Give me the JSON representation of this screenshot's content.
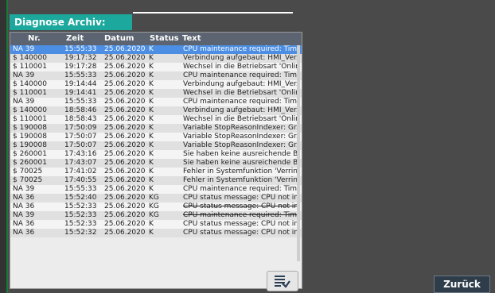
{
  "title": "Diagnose Archiv:",
  "table": {
    "headers": [
      "Nr.",
      "Zeit",
      "Datum",
      "Status",
      "Text"
    ],
    "rows": [
      {
        "nr": "NA  39",
        "zeit": "15:55:33",
        "datum": "25.06.2020",
        "status": "K",
        "text": "CPU maintenance required: Tim...",
        "selected": true
      },
      {
        "nr": "$     140000",
        "zeit": "19:17:32",
        "datum": "25.06.2020",
        "status": "K",
        "text": "Verbindung aufgebaut: HMI_Ver..."
      },
      {
        "nr": "$     110001",
        "zeit": "19:17:28",
        "datum": "25.06.2020",
        "status": "K",
        "text": "Wechsel in die Betriebsart 'Onlin..."
      },
      {
        "nr": "NA  39",
        "zeit": "15:55:33",
        "datum": "25.06.2020",
        "status": "K",
        "text": "CPU maintenance required: Tim..."
      },
      {
        "nr": "$     140000",
        "zeit": "19:14:44",
        "datum": "25.06.2020",
        "status": "K",
        "text": "Verbindung aufgebaut: HMI_Ver..."
      },
      {
        "nr": "$     110001",
        "zeit": "19:14:41",
        "datum": "25.06.2020",
        "status": "K",
        "text": "Wechsel in die Betriebsart 'Onlin..."
      },
      {
        "nr": "NA  39",
        "zeit": "15:55:33",
        "datum": "25.06.2020",
        "status": "K",
        "text": "CPU maintenance required: Tim..."
      },
      {
        "nr": "$     140000",
        "zeit": "18:58:46",
        "datum": "25.06.2020",
        "status": "K",
        "text": "Verbindung aufgebaut: HMI_Ver..."
      },
      {
        "nr": "$     110001",
        "zeit": "18:58:43",
        "datum": "25.06.2020",
        "status": "K",
        "text": "Wechsel in die Betriebsart 'Onlin..."
      },
      {
        "nr": "$     190008",
        "zeit": "17:50:09",
        "datum": "25.06.2020",
        "status": "K",
        "text": "Variable StopReasonIndexer: Gr..."
      },
      {
        "nr": "$     190008",
        "zeit": "17:50:07",
        "datum": "25.06.2020",
        "status": "K",
        "text": "Variable StopReasonIndexer: Gr..."
      },
      {
        "nr": "$     190008",
        "zeit": "17:50:07",
        "datum": "25.06.2020",
        "status": "K",
        "text": "Variable StopReasonIndexer: Gr..."
      },
      {
        "nr": "$     260001",
        "zeit": "17:43:16",
        "datum": "25.06.2020",
        "status": "K",
        "text": "Sie haben keine ausreichende B..."
      },
      {
        "nr": "$     260001",
        "zeit": "17:43:07",
        "datum": "25.06.2020",
        "status": "K",
        "text": "Sie haben keine ausreichende B..."
      },
      {
        "nr": "$     70025",
        "zeit": "17:41:02",
        "datum": "25.06.2020",
        "status": "K",
        "text": "Fehler in Systemfunktion 'Verrin..."
      },
      {
        "nr": "$     70025",
        "zeit": "17:40:55",
        "datum": "25.06.2020",
        "status": "K",
        "text": "Fehler in Systemfunktion 'Verrin..."
      },
      {
        "nr": "NA  39",
        "zeit": "15:55:33",
        "datum": "25.06.2020",
        "status": "K",
        "text": "CPU maintenance required: Tim..."
      },
      {
        "nr": "NA  36",
        "zeit": "15:52:40",
        "datum": "25.06.2020",
        "status": "KG",
        "text": "CPU status message: CPU not in..."
      },
      {
        "nr": "NA  36",
        "zeit": "15:52:33",
        "datum": "25.06.2020",
        "status": "KG",
        "text": "CPU status message: CPU not in...",
        "strike": true
      },
      {
        "nr": "NA  39",
        "zeit": "15:52:33",
        "datum": "25.06.2020",
        "status": "KG",
        "text": "CPU maintenance required: Tim...",
        "strike": true
      },
      {
        "nr": "NA  36",
        "zeit": "15:52:33",
        "datum": "25.06.2020",
        "status": "K",
        "text": "CPU status message: CPU not in..."
      },
      {
        "nr": "NA  36",
        "zeit": "15:52:32",
        "datum": "25.06.2020",
        "status": "K",
        "text": "CPU status message: CPU not in..."
      }
    ]
  },
  "export_icon": "table-export-icon",
  "back_label": "Zurück"
}
